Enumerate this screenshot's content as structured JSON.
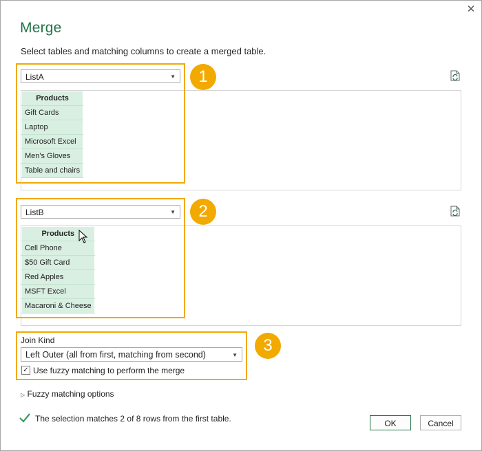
{
  "dialog": {
    "title": "Merge",
    "subtitle": "Select tables and matching columns to create a merged table.",
    "close_icon": "close-icon"
  },
  "table1": {
    "selected": "ListA",
    "header": "Products",
    "rows": [
      "Gift Cards",
      "Laptop",
      "Microsoft Excel",
      "Men's Gloves",
      "Table and chairs"
    ],
    "badge": "1"
  },
  "table2": {
    "selected": "ListB",
    "header": "Products",
    "rows": [
      "Cell Phone",
      "$50 Gift Card",
      "Red Apples",
      "MSFT Excel",
      "Macaroni & Cheese"
    ],
    "badge": "2"
  },
  "join": {
    "label": "Join Kind",
    "selected": "Left Outer (all from first, matching from second)",
    "fuzzy_checkbox_label": "Use fuzzy matching to perform the merge",
    "fuzzy_checked": true,
    "badge": "3"
  },
  "fuzzy_options": {
    "label": "Fuzzy matching options"
  },
  "status": {
    "text": "The selection matches 2 of 8 rows from the first table."
  },
  "buttons": {
    "ok": "OK",
    "cancel": "Cancel"
  },
  "colors": {
    "accent": "#217346",
    "highlight": "#f2a900",
    "selected_col": "#d9efe2"
  }
}
